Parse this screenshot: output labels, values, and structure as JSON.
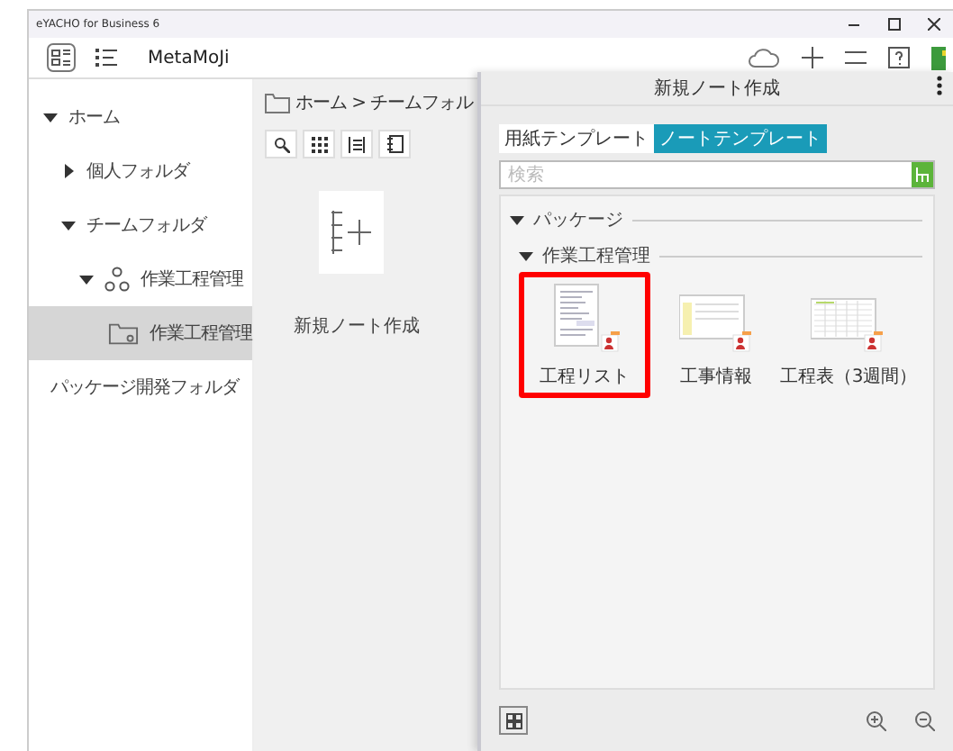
{
  "window": {
    "title": "eYACHO for Business 6"
  },
  "toolbar": {
    "app_name": "MetaMoJi"
  },
  "sidebar": {
    "items": [
      {
        "label": "ホーム",
        "expanded": true,
        "selected": false,
        "children": [
          {
            "label": "個人フォルダ",
            "expanded": false,
            "selected": false
          },
          {
            "label": "チームフォルダ",
            "expanded": true,
            "selected": false,
            "children": [
              {
                "label": "作業工程管理",
                "expanded": true,
                "selected": false,
                "kind": "team",
                "children": [
                  {
                    "label": "作業工程管理",
                    "selected": true,
                    "kind": "team-folder"
                  }
                ]
              }
            ]
          }
        ]
      },
      {
        "label": "パッケージ開発フォルダ",
        "selected": false
      }
    ]
  },
  "content": {
    "breadcrumb": "ホーム > チームフォル",
    "new_note_label": "新規ノート作成"
  },
  "dialog": {
    "title": "新規ノート作成",
    "tabs": [
      {
        "label": "用紙テンプレート",
        "selected": false
      },
      {
        "label": "ノートテンプレート",
        "selected": true
      }
    ],
    "search": {
      "placeholder": "検索"
    },
    "sections": [
      {
        "title": "パッケージ",
        "expanded": true,
        "groups": [
          {
            "title": "作業工程管理",
            "expanded": true,
            "templates": [
              {
                "label": "工程リスト",
                "selected": true,
                "kind": "list"
              },
              {
                "label": "工事情報",
                "selected": false,
                "kind": "info"
              },
              {
                "label": "工程表（3週間）",
                "selected": false,
                "kind": "schedule"
              }
            ]
          }
        ]
      }
    ]
  }
}
